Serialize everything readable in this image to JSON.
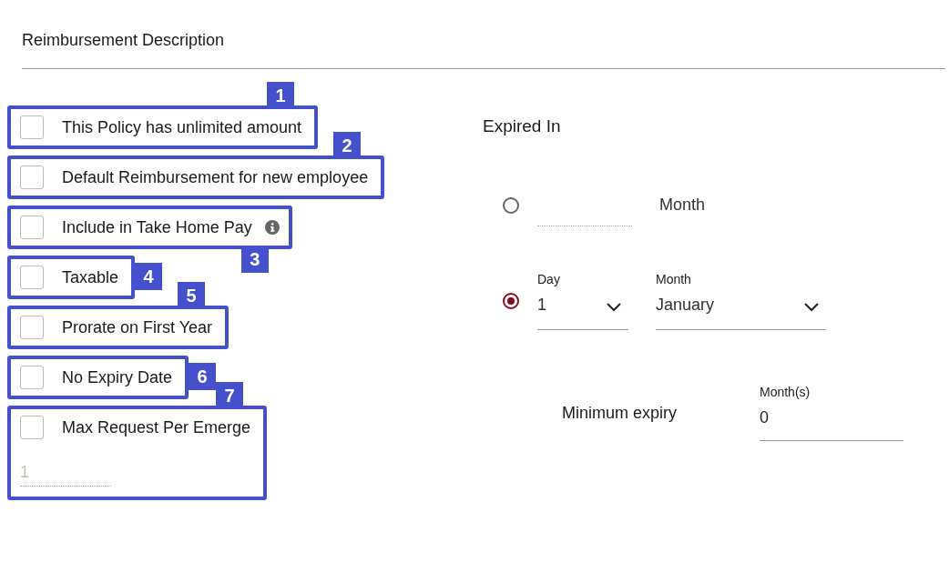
{
  "section_title": "Reimbursement Description",
  "options": [
    {
      "label": "This Policy has unlimited amount",
      "checked": false,
      "annotation": "1"
    },
    {
      "label": "Default Reimbursement for new employee",
      "checked": false,
      "annotation": "2"
    },
    {
      "label": "Include in Take Home Pay",
      "checked": false,
      "annotation": "3",
      "info": true
    },
    {
      "label": "Taxable",
      "checked": false,
      "annotation": "4"
    },
    {
      "label": "Prorate on First Year",
      "checked": false,
      "annotation": "5"
    },
    {
      "label": "No Expiry Date",
      "checked": false,
      "annotation": "6"
    },
    {
      "label": "Max Request Per Emerge",
      "checked": false,
      "annotation": "7",
      "input": {
        "placeholder": "1"
      }
    }
  ],
  "expiry": {
    "title": "Expired In",
    "choices": [
      {
        "kind": "months",
        "selected": false,
        "unit": "Month"
      },
      {
        "kind": "date",
        "selected": true,
        "day_label": "Day",
        "day": "1",
        "month_label": "Month",
        "month": "January"
      }
    ],
    "minimum": {
      "label": "Minimum expiry",
      "field_label": "Month(s)",
      "value": "0"
    }
  }
}
